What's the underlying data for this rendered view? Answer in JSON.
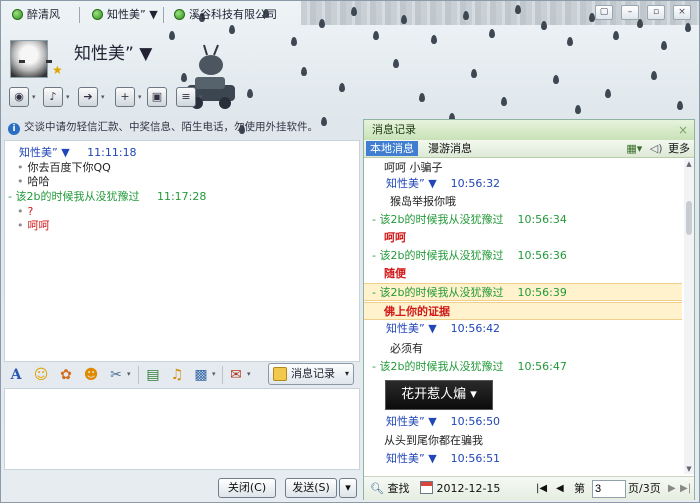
{
  "tabs": [
    {
      "label": "醉清风"
    },
    {
      "label": "知性美” ▼"
    },
    {
      "label": "溪谷科技有限公司"
    }
  ],
  "window_controls": {
    "minimize": "–",
    "restore": "▫",
    "close": "×",
    "menu": "▢"
  },
  "header": {
    "nickname": "知性美” ▼",
    "star": "★"
  },
  "toolbar_top": {
    "items": [
      {
        "icon": "camera-icon",
        "glyph": "◉"
      },
      {
        "icon": "microphone-icon",
        "glyph": "♪"
      },
      {
        "icon": "transfer-file-icon",
        "glyph": "➔"
      },
      {
        "icon": "add-contact-icon",
        "glyph": "+"
      },
      {
        "icon": "remote-assist-icon",
        "glyph": "▣"
      },
      {
        "icon": "document-icon",
        "glyph": "≡"
      }
    ],
    "caret": "▾"
  },
  "notice": {
    "icon": "i",
    "text": "交谈中请勿轻信汇款、中奖信息、陌生电话，勿使用外挂软件。"
  },
  "chat": [
    {
      "kind": "sender",
      "name": "知性美” ▼",
      "time": "11:11:18",
      "color": "blue"
    },
    {
      "kind": "text",
      "text": "你去百度下你QQ"
    },
    {
      "kind": "text",
      "text": "哈哈"
    },
    {
      "kind": "sender",
      "name": "- 该2b的时候我从没犹豫过",
      "time": "11:17:28",
      "color": "green"
    },
    {
      "kind": "text",
      "text": "?",
      "color": "red"
    },
    {
      "kind": "text",
      "text": "呵呵",
      "color": "red"
    }
  ],
  "toolbar_bottom": {
    "font": "A",
    "emoji": "☺",
    "magic": "✿",
    "wink": "☻",
    "screenshot": "✂",
    "image": "▤",
    "music": "♫",
    "shake": "▩",
    "gift": "✉",
    "caret": "▾"
  },
  "history_button": {
    "label": "消息记录",
    "caret": "▾"
  },
  "buttons": {
    "close_label": "关闭(C)",
    "send_label": "发送(S)",
    "send_caret": "▾"
  },
  "history": {
    "title": "消息记录",
    "close": "×",
    "tab_local": "本地消息",
    "tab_roaming": "漫游消息",
    "more": "更多",
    "entries": [
      {
        "kind": "text",
        "text": "呵呵 小骗子",
        "color": "black"
      },
      {
        "kind": "sender",
        "name": "知性美” ▼",
        "time": "10:56:32",
        "color": "blue"
      },
      {
        "kind": "text",
        "text": "猴岛举报你哦",
        "color": "black"
      },
      {
        "kind": "sender",
        "name": "- 该2b的时候我从没犹豫过",
        "time": "10:56:34",
        "color": "green"
      },
      {
        "kind": "text",
        "text": "呵呵",
        "color": "red"
      },
      {
        "kind": "sender",
        "name": "- 该2b的时候我从没犹豫过",
        "time": "10:56:36",
        "color": "green"
      },
      {
        "kind": "text",
        "text": "随便",
        "color": "red"
      },
      {
        "kind": "sender",
        "name": "- 该2b的时候我从没犹豫过",
        "time": "10:56:39",
        "color": "green",
        "highlight": true
      },
      {
        "kind": "text",
        "text": "佛上你的证据",
        "color": "red",
        "highlight": true
      },
      {
        "kind": "sender",
        "name": "知性美” ▼",
        "time": "10:56:42",
        "color": "blue"
      },
      {
        "kind": "text",
        "text": "必须有",
        "color": "black"
      },
      {
        "kind": "sender",
        "name": "- 该2b的时候我从没犹豫过",
        "time": "10:56:47",
        "color": "green"
      },
      {
        "kind": "sticker",
        "text": "花开惹人煸 ▾"
      },
      {
        "kind": "sender",
        "name": "知性美” ▼",
        "time": "10:56:50",
        "color": "blue"
      },
      {
        "kind": "text",
        "text": "从头到尾你都在骗我",
        "color": "black"
      },
      {
        "kind": "sender",
        "name": "知性美” ▼",
        "time": "10:56:51",
        "color": "blue"
      }
    ],
    "footer": {
      "search": "查找",
      "date": "2012-12-15",
      "first": "|◀",
      "prev": "◀",
      "page_prefix": "第",
      "page_value": "3",
      "page_suffix": "页/3页",
      "next": "▶",
      "last": "▶|"
    }
  }
}
